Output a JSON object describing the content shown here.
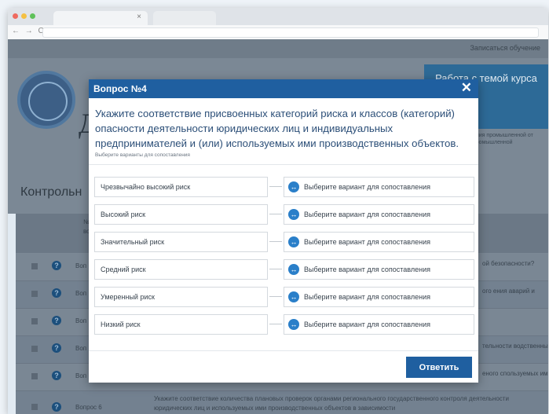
{
  "browser": {
    "colors": {
      "dot_red": "#ef6a5f",
      "dot_yellow": "#f5c043",
      "dot_green": "#5fc15a"
    },
    "tab_close": "×",
    "nav_glyphs": "← → C"
  },
  "background": {
    "feedback_label": "Записаться обучение",
    "site_letter": "Д",
    "course_box_title": "Работа с темой курса",
    "course_box_sub": "курса",
    "side_note": "ания промышленной от промышленной",
    "control_title": "Контрольн",
    "table_header": {
      "num_label": "№",
      "num_sub": "воп"
    },
    "rows": [
      {
        "label": "Воп",
        "right": "ой безопасности?"
      },
      {
        "label": "Воп",
        "right": "ого ения аварий и"
      },
      {
        "label": "Воп",
        "right": ""
      },
      {
        "label": "Воп",
        "right": "тельности водственных"
      },
      {
        "label": "Воп",
        "right": "еного спользуемых ими"
      },
      {
        "label": "Вопрос 6",
        "right": ""
      }
    ],
    "bottom_text": "Укажите соответствие количества плановых проверок органами регионального государственного контроля деятельности юридических лиц и используемых ими производственных объектов в зависимости"
  },
  "modal": {
    "title": "Вопрос №4",
    "close_label": "✕",
    "question": "Укажите соответствие присвоенных категорий риска и классов (категорий) опасности деятельности юридических лиц и индивидуальных предпринимателей и (или) используемых ими производственных объектов.",
    "hint": "Выберите варианты для сопоставления",
    "pairs": [
      {
        "left": "Чрезвычайно высокий риск",
        "right": "Выберите вариант для сопоставления"
      },
      {
        "left": "Высокий риск",
        "right": "Выберите вариант для сопоставления"
      },
      {
        "left": "Значительный риск",
        "right": "Выберите вариант для сопоставления"
      },
      {
        "left": "Средний риск",
        "right": "Выберите вариант для сопоставления"
      },
      {
        "left": "Умеренный риск",
        "right": "Выберите вариант для сопоставления"
      },
      {
        "left": "Низкий риск",
        "right": "Выберите вариант для сопоставления"
      }
    ],
    "swap_icon_glyph": "↔",
    "answer_button": "Ответить"
  }
}
